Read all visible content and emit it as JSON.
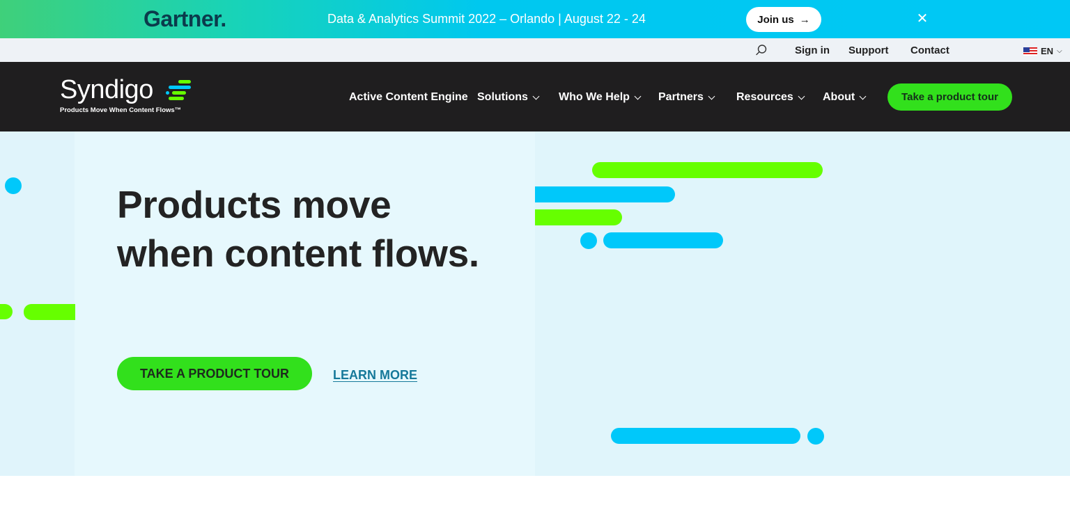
{
  "promo": {
    "brand": "Gartner",
    "brand_dot": ".",
    "headline": "Data & Analytics Summit 2022 – Orlando | August 22 - 24",
    "join_label": "Join us",
    "join_arrow": "→",
    "close_glyph": "✕"
  },
  "utility": {
    "sign_in": "Sign in",
    "support": "Support",
    "contact": "Contact",
    "language": "EN",
    "language_chevron": "⌵"
  },
  "nav": {
    "logo_word": "Syndigo",
    "logo_tagline": "Products Move When Content Flows™",
    "items": [
      {
        "label": "Active Content Engine"
      },
      {
        "label": "Solutions"
      },
      {
        "label": "Who We Help"
      },
      {
        "label": "Partners"
      },
      {
        "label": "Resources"
      },
      {
        "label": "About"
      }
    ],
    "cta_label": "Take a product tour"
  },
  "hero": {
    "heading": "Products move when content flows.",
    "tour_button": "TAKE A PRODUCT TOUR",
    "learn_more": "LEARN MORE"
  },
  "colors": {
    "green": "#32e01c",
    "lime": "#66ff00",
    "cyan": "#00c8fa",
    "dark_nav": "#1f1e1f",
    "hero_bg": "#e6f8fd",
    "link": "#16799a"
  }
}
